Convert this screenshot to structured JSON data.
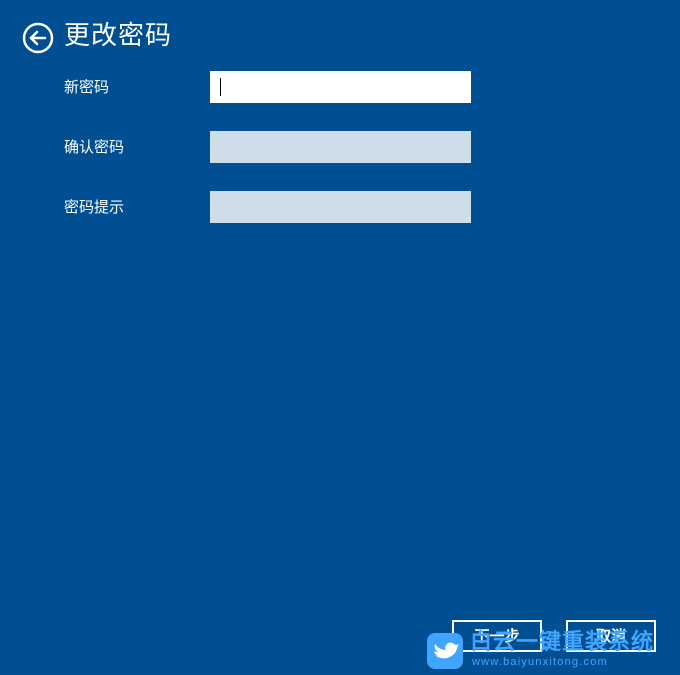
{
  "header": {
    "back_icon": "back-arrow-circle-icon",
    "title": "更改密码"
  },
  "form": {
    "fields": [
      {
        "label": "新密码",
        "value": "",
        "active": true
      },
      {
        "label": "确认密码",
        "value": "",
        "active": false
      },
      {
        "label": "密码提示",
        "value": "",
        "active": false
      }
    ]
  },
  "buttons": {
    "next_label": "下一步",
    "cancel_label": "取消"
  },
  "watermark": {
    "icon": "bird-logo-icon",
    "title": "白云一键重装系统",
    "url": "www.baiyunxitong.com"
  },
  "colors": {
    "background": "#004f93",
    "input_active": "#ffffff",
    "input_inactive": "#cddde9",
    "watermark": "#3fa5ff"
  }
}
